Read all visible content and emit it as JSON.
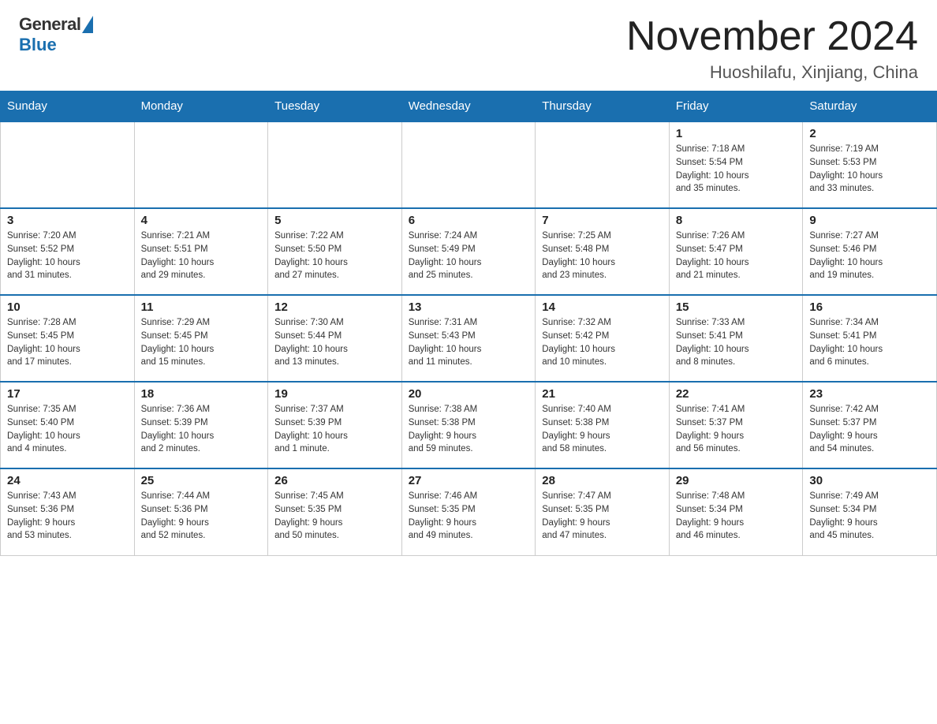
{
  "header": {
    "logo_general": "General",
    "logo_blue": "Blue",
    "month_title": "November 2024",
    "location": "Huoshilafu, Xinjiang, China"
  },
  "weekdays": [
    "Sunday",
    "Monday",
    "Tuesday",
    "Wednesday",
    "Thursday",
    "Friday",
    "Saturday"
  ],
  "weeks": [
    [
      {
        "day": "",
        "info": ""
      },
      {
        "day": "",
        "info": ""
      },
      {
        "day": "",
        "info": ""
      },
      {
        "day": "",
        "info": ""
      },
      {
        "day": "",
        "info": ""
      },
      {
        "day": "1",
        "info": "Sunrise: 7:18 AM\nSunset: 5:54 PM\nDaylight: 10 hours\nand 35 minutes."
      },
      {
        "day": "2",
        "info": "Sunrise: 7:19 AM\nSunset: 5:53 PM\nDaylight: 10 hours\nand 33 minutes."
      }
    ],
    [
      {
        "day": "3",
        "info": "Sunrise: 7:20 AM\nSunset: 5:52 PM\nDaylight: 10 hours\nand 31 minutes."
      },
      {
        "day": "4",
        "info": "Sunrise: 7:21 AM\nSunset: 5:51 PM\nDaylight: 10 hours\nand 29 minutes."
      },
      {
        "day": "5",
        "info": "Sunrise: 7:22 AM\nSunset: 5:50 PM\nDaylight: 10 hours\nand 27 minutes."
      },
      {
        "day": "6",
        "info": "Sunrise: 7:24 AM\nSunset: 5:49 PM\nDaylight: 10 hours\nand 25 minutes."
      },
      {
        "day": "7",
        "info": "Sunrise: 7:25 AM\nSunset: 5:48 PM\nDaylight: 10 hours\nand 23 minutes."
      },
      {
        "day": "8",
        "info": "Sunrise: 7:26 AM\nSunset: 5:47 PM\nDaylight: 10 hours\nand 21 minutes."
      },
      {
        "day": "9",
        "info": "Sunrise: 7:27 AM\nSunset: 5:46 PM\nDaylight: 10 hours\nand 19 minutes."
      }
    ],
    [
      {
        "day": "10",
        "info": "Sunrise: 7:28 AM\nSunset: 5:45 PM\nDaylight: 10 hours\nand 17 minutes."
      },
      {
        "day": "11",
        "info": "Sunrise: 7:29 AM\nSunset: 5:45 PM\nDaylight: 10 hours\nand 15 minutes."
      },
      {
        "day": "12",
        "info": "Sunrise: 7:30 AM\nSunset: 5:44 PM\nDaylight: 10 hours\nand 13 minutes."
      },
      {
        "day": "13",
        "info": "Sunrise: 7:31 AM\nSunset: 5:43 PM\nDaylight: 10 hours\nand 11 minutes."
      },
      {
        "day": "14",
        "info": "Sunrise: 7:32 AM\nSunset: 5:42 PM\nDaylight: 10 hours\nand 10 minutes."
      },
      {
        "day": "15",
        "info": "Sunrise: 7:33 AM\nSunset: 5:41 PM\nDaylight: 10 hours\nand 8 minutes."
      },
      {
        "day": "16",
        "info": "Sunrise: 7:34 AM\nSunset: 5:41 PM\nDaylight: 10 hours\nand 6 minutes."
      }
    ],
    [
      {
        "day": "17",
        "info": "Sunrise: 7:35 AM\nSunset: 5:40 PM\nDaylight: 10 hours\nand 4 minutes."
      },
      {
        "day": "18",
        "info": "Sunrise: 7:36 AM\nSunset: 5:39 PM\nDaylight: 10 hours\nand 2 minutes."
      },
      {
        "day": "19",
        "info": "Sunrise: 7:37 AM\nSunset: 5:39 PM\nDaylight: 10 hours\nand 1 minute."
      },
      {
        "day": "20",
        "info": "Sunrise: 7:38 AM\nSunset: 5:38 PM\nDaylight: 9 hours\nand 59 minutes."
      },
      {
        "day": "21",
        "info": "Sunrise: 7:40 AM\nSunset: 5:38 PM\nDaylight: 9 hours\nand 58 minutes."
      },
      {
        "day": "22",
        "info": "Sunrise: 7:41 AM\nSunset: 5:37 PM\nDaylight: 9 hours\nand 56 minutes."
      },
      {
        "day": "23",
        "info": "Sunrise: 7:42 AM\nSunset: 5:37 PM\nDaylight: 9 hours\nand 54 minutes."
      }
    ],
    [
      {
        "day": "24",
        "info": "Sunrise: 7:43 AM\nSunset: 5:36 PM\nDaylight: 9 hours\nand 53 minutes."
      },
      {
        "day": "25",
        "info": "Sunrise: 7:44 AM\nSunset: 5:36 PM\nDaylight: 9 hours\nand 52 minutes."
      },
      {
        "day": "26",
        "info": "Sunrise: 7:45 AM\nSunset: 5:35 PM\nDaylight: 9 hours\nand 50 minutes."
      },
      {
        "day": "27",
        "info": "Sunrise: 7:46 AM\nSunset: 5:35 PM\nDaylight: 9 hours\nand 49 minutes."
      },
      {
        "day": "28",
        "info": "Sunrise: 7:47 AM\nSunset: 5:35 PM\nDaylight: 9 hours\nand 47 minutes."
      },
      {
        "day": "29",
        "info": "Sunrise: 7:48 AM\nSunset: 5:34 PM\nDaylight: 9 hours\nand 46 minutes."
      },
      {
        "day": "30",
        "info": "Sunrise: 7:49 AM\nSunset: 5:34 PM\nDaylight: 9 hours\nand 45 minutes."
      }
    ]
  ]
}
